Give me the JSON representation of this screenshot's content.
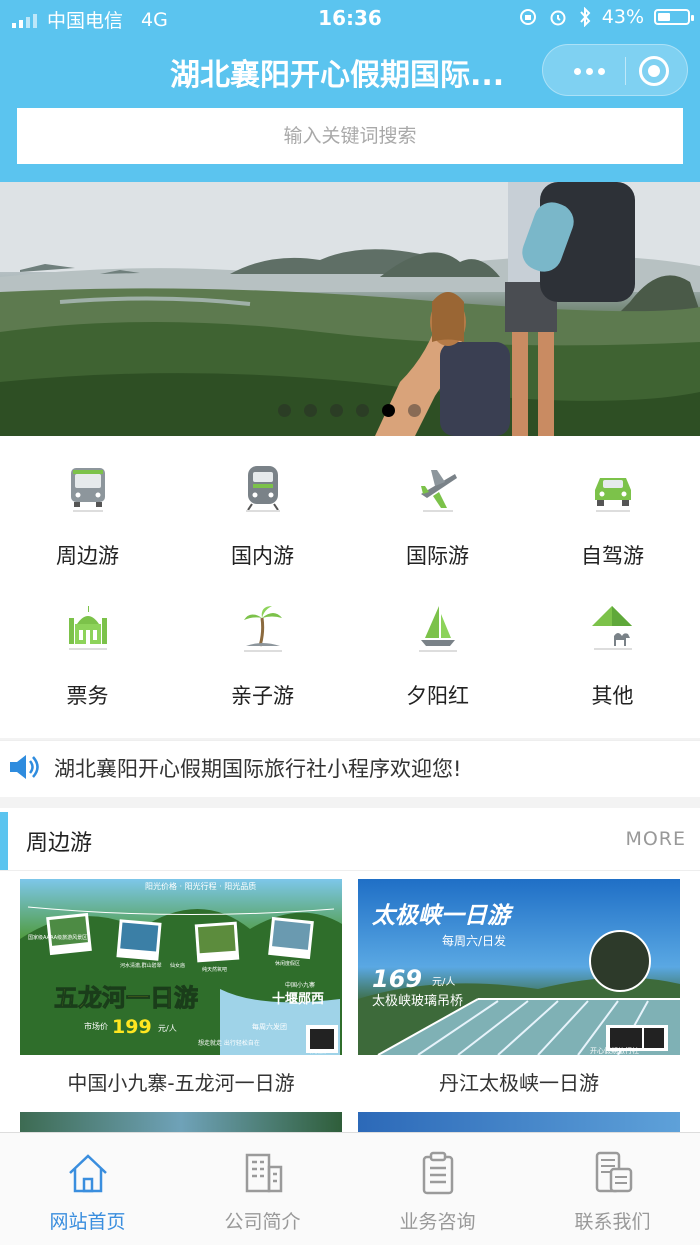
{
  "status_bar": {
    "carrier": "中国电信",
    "network": "4G",
    "time": "16:36",
    "battery_text": "43%",
    "battery_level": 0.43
  },
  "navbar": {
    "title": "湖北襄阳开心假期国际..."
  },
  "search": {
    "placeholder": "输入关键词搜索"
  },
  "banner": {
    "slide_count": 6,
    "active_index": 4
  },
  "categories": [
    {
      "label": "周边游",
      "icon": "bus-icon"
    },
    {
      "label": "国内游",
      "icon": "train-icon"
    },
    {
      "label": "国际游",
      "icon": "airplane-icon"
    },
    {
      "label": "自驾游",
      "icon": "car-icon"
    },
    {
      "label": "票务",
      "icon": "mosque-icon"
    },
    {
      "label": "亲子游",
      "icon": "palm-island-icon"
    },
    {
      "label": "夕阳红",
      "icon": "sailboat-icon"
    },
    {
      "label": "其他",
      "icon": "pyramid-camel-icon"
    }
  ],
  "notice": {
    "text": "湖北襄阳开心假期国际旅行社小程序欢迎您!",
    "icon": "speaker-icon"
  },
  "section": {
    "title": "周边游",
    "more": "MORE"
  },
  "products": [
    {
      "title": "中国小九寨-五龙河一日游",
      "poster": {
        "top_line": "阳光价格 · 阳光行程 · 阳光品质",
        "headline": "五龙河一日游",
        "side": "十堰郧西",
        "side_small": "中国小九寨",
        "price_label": "市场价",
        "price": "199",
        "price_unit": "元/人",
        "schedule": "每周六发团",
        "slogan": "想走就走 出行轻松自在",
        "photo_captions": [
          "国家级AAAA级旅游风景区",
          "河水清澈,群山碧翠",
          "仙女庙",
          "纯天然氧吧",
          "休闲度假区"
        ],
        "footer": "开心假期"
      }
    },
    {
      "title": "丹江太极峡一日游",
      "poster": {
        "headline": "太极峡一日游",
        "schedule": "每周六/日发",
        "price": "169",
        "price_unit": "元/人",
        "subtitle": "太极峡玻璃吊桥",
        "footer": "开心假期旅行社"
      }
    }
  ],
  "tabbar": [
    {
      "label": "网站首页",
      "icon": "home-icon",
      "active": true
    },
    {
      "label": "公司简介",
      "icon": "building-icon",
      "active": false
    },
    {
      "label": "业务咨询",
      "icon": "clipboard-icon",
      "active": false
    },
    {
      "label": "联系我们",
      "icon": "phone-contact-icon",
      "active": false
    }
  ],
  "colors": {
    "theme": "#5bc4ef",
    "active_tab": "#3a8ede",
    "icon_green": "#7cc24a"
  }
}
